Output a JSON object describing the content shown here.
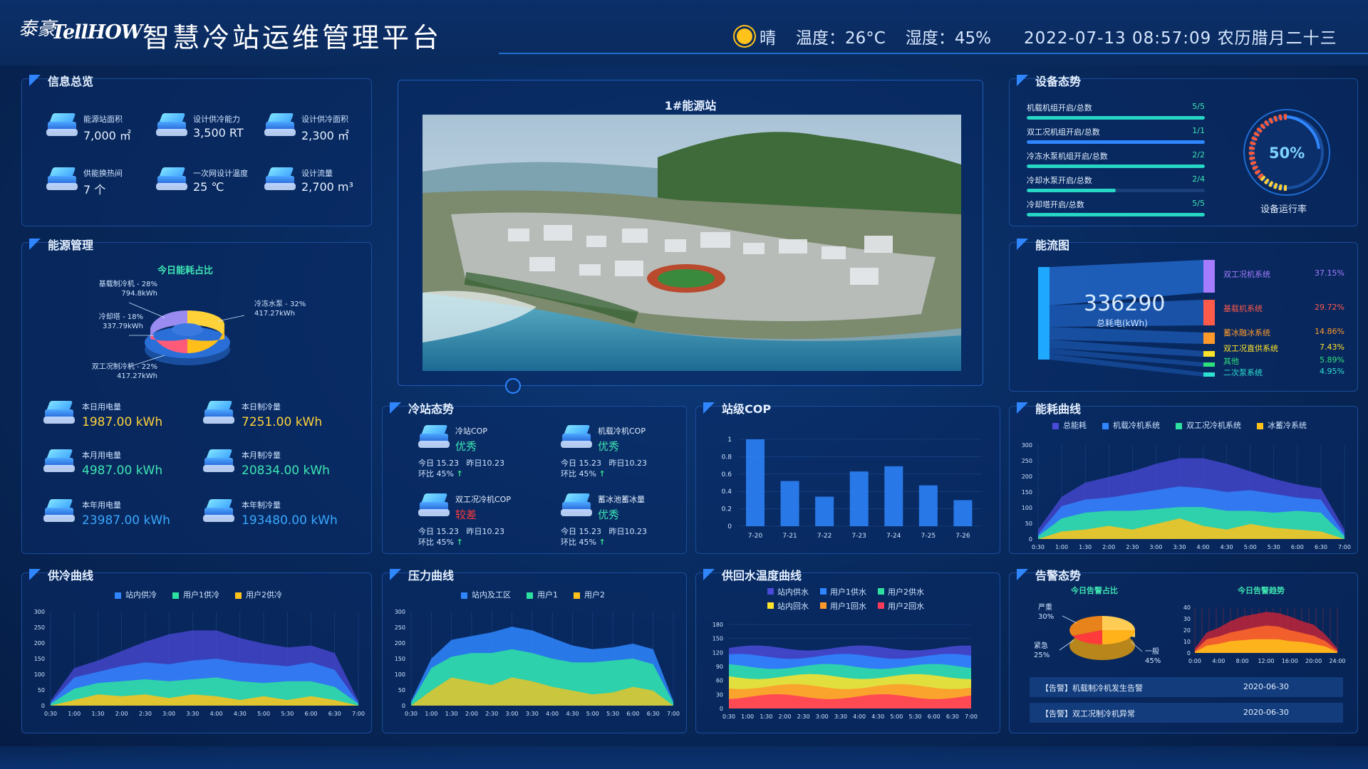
{
  "header": {
    "logo_cn": "泰豪",
    "logo_en": "TellHOW",
    "title": "智慧冷站运维管理平台",
    "weather": "晴",
    "temperature": "温度：26°C",
    "humidity": "湿度：45%",
    "datetime": "2022-07-13  08:57:09  农历腊月二十三"
  },
  "info_overview": {
    "title": "信息总览",
    "items": [
      {
        "label": "能源站面积",
        "value": "7,000 ㎡"
      },
      {
        "label": "设计供冷能力",
        "value": "3,500 RT"
      },
      {
        "label": "设计供冷面积",
        "value": "2,300 ㎡"
      },
      {
        "label": "供能换热间",
        "value": "7 个"
      },
      {
        "label": "一次网设计温度",
        "value": "25 ℃"
      },
      {
        "label": "设计流量",
        "value": "2,700 m³"
      }
    ]
  },
  "energy_mgmt": {
    "title": "能源管理",
    "pie_title": "今日能耗占比",
    "pie_labels": [
      {
        "name": "基载制冷机 - 28%",
        "value": "794.8kWh"
      },
      {
        "name": "冷冻水泵 - 32%",
        "value": "417.27kWh"
      },
      {
        "name": "冷却塔 - 18%",
        "value": "337.79kWh"
      },
      {
        "name": "双工况制冷机 - 22%",
        "value": "417.27kWh"
      }
    ],
    "stats": [
      {
        "label": "本日用电量",
        "value": "1987.00 kWh",
        "color": "#ffd23a"
      },
      {
        "label": "本日制冷量",
        "value": "7251.00 kWh",
        "color": "#ffd23a"
      },
      {
        "label": "本月用电量",
        "value": "4987.00 kWh",
        "color": "#3ee5b2"
      },
      {
        "label": "本月制冷量",
        "value": "20834.00 kWh",
        "color": "#3ee5b2"
      },
      {
        "label": "本年用电量",
        "value": "23987.00 kWh",
        "color": "#3aa8ff"
      },
      {
        "label": "本年制冷量",
        "value": "193480.00 kWh",
        "color": "#3aa8ff"
      }
    ]
  },
  "station": {
    "title": "1#能源站"
  },
  "equipment": {
    "title": "设备态势",
    "rows": [
      {
        "label": "机载机组开启/总数",
        "count": "5/5",
        "ratio": 1.0,
        "color": "#27d6c4"
      },
      {
        "label": "双工况机组开启/总数",
        "count": "1/1",
        "ratio": 1.0,
        "color": "#2f86ff"
      },
      {
        "label": "冷冻水泵机组开启/总数",
        "count": "2/2",
        "ratio": 1.0,
        "color": "#27d6c4"
      },
      {
        "label": "冷却水泵开启/总数",
        "count": "2/4",
        "ratio": 0.5,
        "color": "#27d6c4"
      },
      {
        "label": "冷却塔开启/总数",
        "count": "5/5",
        "ratio": 1.0,
        "color": "#27d6c4"
      }
    ],
    "gauge_value": "50%",
    "gauge_label": "设备运行率"
  },
  "energy_flow": {
    "title": "能流图",
    "total": "336290",
    "total_label": "总耗电(kWh)",
    "items": [
      {
        "name": "双工况机系统",
        "pct": "37.15%",
        "color": "#a57bff"
      },
      {
        "name": "基载机系统",
        "pct": "29.72%",
        "color": "#ff5a4a"
      },
      {
        "name": "蓄冰融冰系统",
        "pct": "14.86%",
        "color": "#ff9a2a"
      },
      {
        "name": "双工况直供系统",
        "pct": "7.43%",
        "color": "#ffe22a"
      },
      {
        "name": "其他",
        "pct": "5.89%",
        "color": "#2ee07a"
      },
      {
        "name": "二次泵系统",
        "pct": "4.95%",
        "color": "#2ee0d0"
      }
    ]
  },
  "cold_station": {
    "title": "冷站态势",
    "items": [
      {
        "name": "冷站COP",
        "grade": "优秀",
        "grade_color": "#3ee5b2",
        "today": "今日 15.23",
        "yesterday": "昨日10.23",
        "ratio": "环比 45%"
      },
      {
        "name": "机载冷机COP",
        "grade": "优秀",
        "grade_color": "#3ee5b2",
        "today": "今日 15.23",
        "yesterday": "昨日10.23",
        "ratio": "环比 45%"
      },
      {
        "name": "双工况冷机COP",
        "grade": "较差",
        "grade_color": "#ff3a3a",
        "today": "今日 15.23",
        "yesterday": "昨日10.23",
        "ratio": "环比 45%"
      },
      {
        "name": "蓄冰池蓄冰量",
        "grade": "优秀",
        "grade_color": "#3ee5b2",
        "today": "今日 15.23",
        "yesterday": "昨日10.23",
        "ratio": "环比 45%"
      }
    ]
  },
  "station_cop": {
    "title": "站级COP",
    "y_ticks": [
      "1",
      "0.8",
      "0.6",
      "0.4",
      "0.2",
      "0"
    ],
    "categories": [
      "7-20",
      "7-21",
      "7-22",
      "7-23",
      "7-24",
      "7-25",
      "7-26"
    ],
    "values": [
      1.0,
      0.52,
      0.34,
      0.63,
      0.69,
      0.47,
      0.3
    ]
  },
  "energy_curve": {
    "title": "能耗曲线",
    "legend": [
      {
        "name": "总能耗",
        "color": "#4a4ad8"
      },
      {
        "name": "机载冷机系统",
        "color": "#2f86ff"
      },
      {
        "name": "双工况冷机系统",
        "color": "#2ee0a0"
      },
      {
        "name": "冰蓄冷系统",
        "color": "#ffc21a"
      }
    ],
    "y_ticks": [
      "300",
      "250",
      "200",
      "150",
      "100",
      "50",
      "0"
    ],
    "x_ticks": [
      "0:30",
      "1:00",
      "1:30",
      "2:00",
      "2:30",
      "3:00",
      "3:30",
      "4:00",
      "4:30",
      "5:00",
      "5:30",
      "6:00",
      "6:30",
      "7:00"
    ]
  },
  "supply_curve": {
    "title": "供冷曲线",
    "legend": [
      {
        "name": "站内供冷",
        "color": "#2f86ff"
      },
      {
        "name": "用户1供冷",
        "color": "#2ee0a0"
      },
      {
        "name": "用户2供冷",
        "color": "#ffc21a"
      }
    ],
    "y_ticks": [
      "300",
      "250",
      "200",
      "150",
      "100",
      "50",
      "0"
    ],
    "x_ticks": [
      "0:30",
      "1:00",
      "1:30",
      "2:00",
      "2:30",
      "3:00",
      "3:30",
      "4:00",
      "4:30",
      "5:00",
      "5:30",
      "6:00",
      "6:30",
      "7:00"
    ]
  },
  "pressure_curve": {
    "title": "压力曲线",
    "legend": [
      {
        "name": "站内及工区",
        "color": "#2f86ff"
      },
      {
        "name": "用户1",
        "color": "#2ee0a0"
      },
      {
        "name": "用户2",
        "color": "#ffc21a"
      }
    ],
    "y_ticks": [
      "300",
      "250",
      "200",
      "150",
      "100",
      "50",
      "0"
    ],
    "x_ticks": [
      "0:30",
      "1:00",
      "1:30",
      "2:00",
      "2:30",
      "3:00",
      "3:30",
      "4:00",
      "4:30",
      "5:00",
      "5:30",
      "6:00",
      "6:30",
      "7:00"
    ]
  },
  "water_temp_curve": {
    "title": "供回水温度曲线",
    "legend": [
      {
        "name": "站内供水",
        "color": "#4a4ad8"
      },
      {
        "name": "用户1供水",
        "color": "#2f86ff"
      },
      {
        "name": "用户2供水",
        "color": "#2ee0a0"
      },
      {
        "name": "站内回水",
        "color": "#ffe22a"
      },
      {
        "name": "用户1回水",
        "color": "#ff9a2a"
      },
      {
        "name": "用户2回水",
        "color": "#ff3a5a"
      }
    ],
    "y_ticks": [
      "180",
      "150",
      "120",
      "90",
      "60",
      "30",
      "0"
    ],
    "x_ticks": [
      "0:30",
      "1:00",
      "1:30",
      "2:00",
      "2:30",
      "3:00",
      "3:30",
      "4:00",
      "4:30",
      "5:00",
      "5:30",
      "6:00",
      "6:30",
      "7:00"
    ]
  },
  "alarm": {
    "title": "告警态势",
    "pie_title": "今日告警占比",
    "trend_title": "今日告警趋势",
    "pie_labels": [
      {
        "name": "严重",
        "pct": "30%"
      },
      {
        "name": "紧急",
        "pct": "25%"
      },
      {
        "name": "一般",
        "pct": "45%"
      }
    ],
    "trend_y_ticks": [
      "40",
      "30",
      "20",
      "10",
      "0"
    ],
    "trend_x_ticks": [
      "0:00",
      "4:00",
      "8:00",
      "12:00",
      "16:00",
      "20:00",
      "24:00"
    ],
    "rows": [
      {
        "msg": "【告警】机载制冷机发生告警",
        "date": "2020-06-30"
      },
      {
        "msg": "【告警】双工况制冷机异常",
        "date": "2020-06-30"
      }
    ]
  }
}
